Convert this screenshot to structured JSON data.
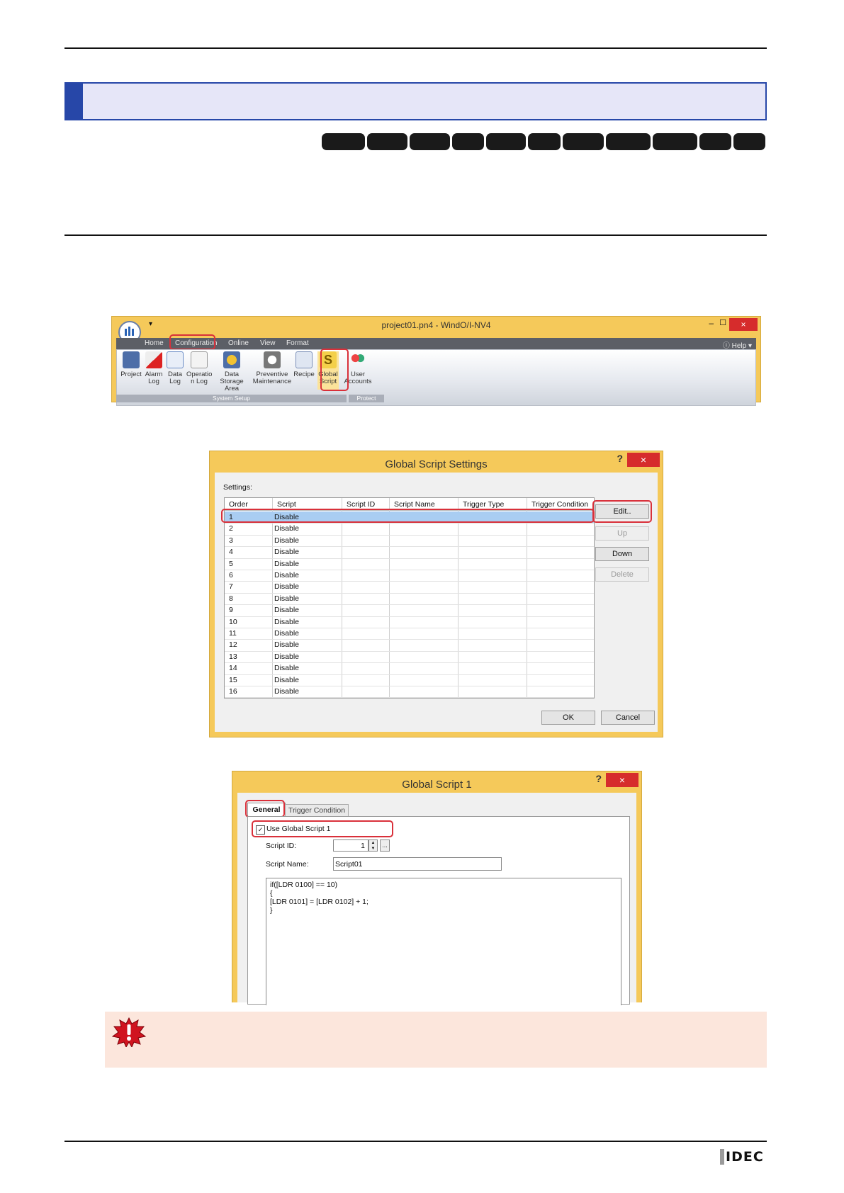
{
  "ribbon_window": {
    "title": "project01.pn4 - WindO/I-NV4",
    "menu": [
      "Home",
      "Configuration",
      "Online",
      "View",
      "Format"
    ],
    "help": "Help",
    "items": [
      {
        "line1": "Project",
        "line2": ""
      },
      {
        "line1": "Alarm",
        "line2": "Log"
      },
      {
        "line1": "Data",
        "line2": "Log"
      },
      {
        "line1": "Operatio",
        "line2": "n Log"
      },
      {
        "line1": "Data Storage",
        "line2": "Area"
      },
      {
        "line1": "Preventive",
        "line2": "Maintenance"
      },
      {
        "line1": "Recipe",
        "line2": ""
      },
      {
        "line1": "Global",
        "line2": "Script"
      },
      {
        "line1": "User",
        "line2": "Accounts"
      }
    ],
    "groups": {
      "system_setup": "System Setup",
      "protect": "Protect"
    }
  },
  "settings_dialog": {
    "title": "Global Script Settings",
    "help": "?",
    "close": "×",
    "settings_label": "Settings:",
    "columns": [
      "Order",
      "Script",
      "Script ID",
      "Script Name",
      "Trigger Type",
      "Trigger Condition"
    ],
    "rows": [
      {
        "order": "1",
        "script": "Disable"
      },
      {
        "order": "2",
        "script": "Disable"
      },
      {
        "order": "3",
        "script": "Disable"
      },
      {
        "order": "4",
        "script": "Disable"
      },
      {
        "order": "5",
        "script": "Disable"
      },
      {
        "order": "6",
        "script": "Disable"
      },
      {
        "order": "7",
        "script": "Disable"
      },
      {
        "order": "8",
        "script": "Disable"
      },
      {
        "order": "9",
        "script": "Disable"
      },
      {
        "order": "10",
        "script": "Disable"
      },
      {
        "order": "11",
        "script": "Disable"
      },
      {
        "order": "12",
        "script": "Disable"
      },
      {
        "order": "13",
        "script": "Disable"
      },
      {
        "order": "14",
        "script": "Disable"
      },
      {
        "order": "15",
        "script": "Disable"
      },
      {
        "order": "16",
        "script": "Disable"
      }
    ],
    "buttons": {
      "edit": "Edit..",
      "up": "Up",
      "down": "Down",
      "delete": "Delete",
      "ok": "OK",
      "cancel": "Cancel"
    }
  },
  "script_dialog": {
    "title": "Global Script 1",
    "help": "?",
    "close": "×",
    "tabs": [
      "General",
      "Trigger Condition"
    ],
    "use_label": "Use Global Script 1",
    "script_id_label": "Script ID:",
    "script_id_value": "1",
    "browse": "...",
    "script_name_label": "Script Name:",
    "script_name_value": "Script01",
    "code": [
      "if([LDR 0100] == 10)",
      "{",
      "[LDR 0101] = [LDR 0102] + 1;",
      "}"
    ]
  },
  "footer": {
    "logo": "IDEC"
  },
  "colors": {
    "window_frame": "#f5c95a",
    "banner_blue": "#2747a8",
    "highlight_red": "#d9303a",
    "warning_bg": "#fce6dc"
  }
}
